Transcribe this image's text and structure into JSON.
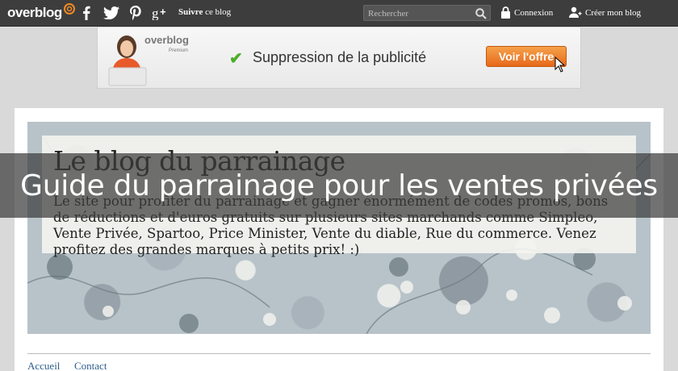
{
  "topbar": {
    "logo": "overblog",
    "follow_bold": "Suivre",
    "follow_rest": " ce blog",
    "search_placeholder": "Rechercher",
    "login": "Connexion",
    "create": "Créer mon blog",
    "social": [
      "facebook-icon",
      "twitter-icon",
      "pinterest-icon",
      "google-plus-icon"
    ],
    "colors": {
      "bar": "#3d3d3d",
      "text": "#ffffff"
    }
  },
  "ad": {
    "brand": "overblog",
    "brand_sub": "Premium",
    "text": "Suppression de la publicité",
    "button": "Voir l'offre",
    "colors": {
      "button": "#e7691b",
      "check": "#4caf2a"
    }
  },
  "blog": {
    "title": "Le blog du parrainage",
    "description": "Le site pour profiter du parrainage et gagner énormément de codes promos, bons de réductions et d'euros gratuits sur plusieurs sites marchands comme Simpleo, Vente Privée, Spartoo, Price Minister, Vente du diable, Rue du commerce. Venez profitez des grandes marques à petits prix! :)"
  },
  "nav": {
    "items": [
      "Accueil",
      "Contact"
    ],
    "color": "#2f5d8c"
  },
  "overlay": {
    "title": "Guide du parrainage pour les ventes privées"
  }
}
